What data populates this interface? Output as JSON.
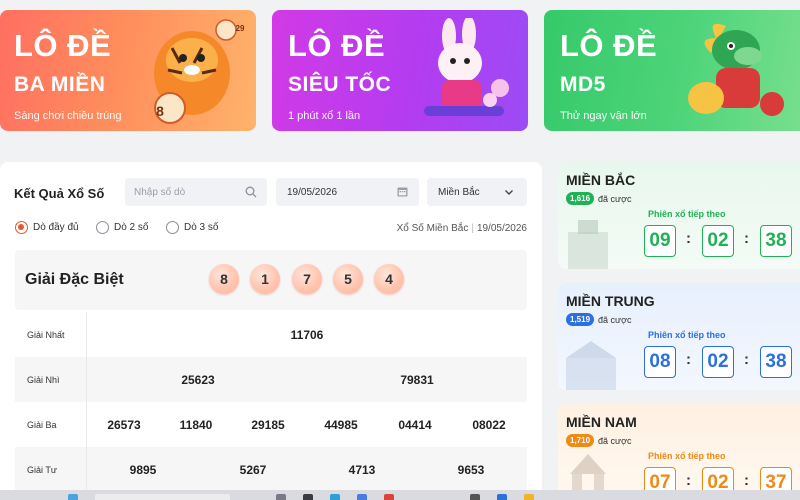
{
  "banners": [
    {
      "line1": "LÔ ĐỀ",
      "line2": "BA MIỀN",
      "subtitle": "Sảng chơi chiều trúng",
      "mascot": "tiger-mascot-icon",
      "ball_number": "8",
      "corner_number": "29"
    },
    {
      "line1": "LÔ ĐỀ",
      "line2": "SIÊU TỐC",
      "subtitle": "1 phút xổ 1 lần",
      "mascot": "rabbit-mascot-icon"
    },
    {
      "line1": "LÔ ĐỀ",
      "line2": "MD5",
      "subtitle": "Thử ngay vận lớn",
      "mascot": "dragon-mascot-icon"
    }
  ],
  "results": {
    "title": "Kết Quả Xổ Số",
    "search_placeholder": "Nhập số dò",
    "date": "19/05/2026",
    "region_select": "Miền Bắc",
    "radios": [
      "Dò đầy đủ",
      "Dò 2 số",
      "Dò 3 số"
    ],
    "selected_radio": "Dò đầy đủ",
    "meta_region": "Xổ Số Miền Bắc",
    "meta_date": "19/05/2026",
    "special": {
      "label": "Giải Đặc Biệt",
      "balls": [
        "8",
        "1",
        "7",
        "5",
        "4"
      ]
    },
    "prizes": [
      {
        "name": "Giải Nhất",
        "values": [
          "11706"
        ]
      },
      {
        "name": "Giải Nhì",
        "values": [
          "25623",
          "79831"
        ]
      },
      {
        "name": "Giải Ba",
        "values": [
          "26573",
          "11840",
          "29185",
          "44985",
          "04414",
          "08022"
        ]
      },
      {
        "name": "Giải Tư",
        "values": [
          "9895",
          "5267",
          "4713",
          "9653"
        ]
      }
    ]
  },
  "regions": [
    {
      "name": "MIỀN BẮC",
      "count": "1,616",
      "count_label": "đã cược",
      "next_label": "Phiên xổ tiếp theo",
      "time": [
        "09",
        "02",
        "38"
      ],
      "color": "#1fb254"
    },
    {
      "name": "MIỀN TRUNG",
      "count": "1,519",
      "count_label": "đã cược",
      "next_label": "Phiên xổ tiếp theo",
      "time": [
        "08",
        "02",
        "38"
      ],
      "color": "#2c6fe0"
    },
    {
      "name": "MIỀN NAM",
      "count": "1,710",
      "count_label": "đã cược",
      "next_label": "Phiên xổ tiếp theo",
      "time": [
        "07",
        "02",
        "37"
      ],
      "color": "#f08a14"
    }
  ],
  "icons": {
    "search": "search-icon",
    "calendar": "calendar-icon",
    "dropdown": "chevron-down-icon"
  }
}
